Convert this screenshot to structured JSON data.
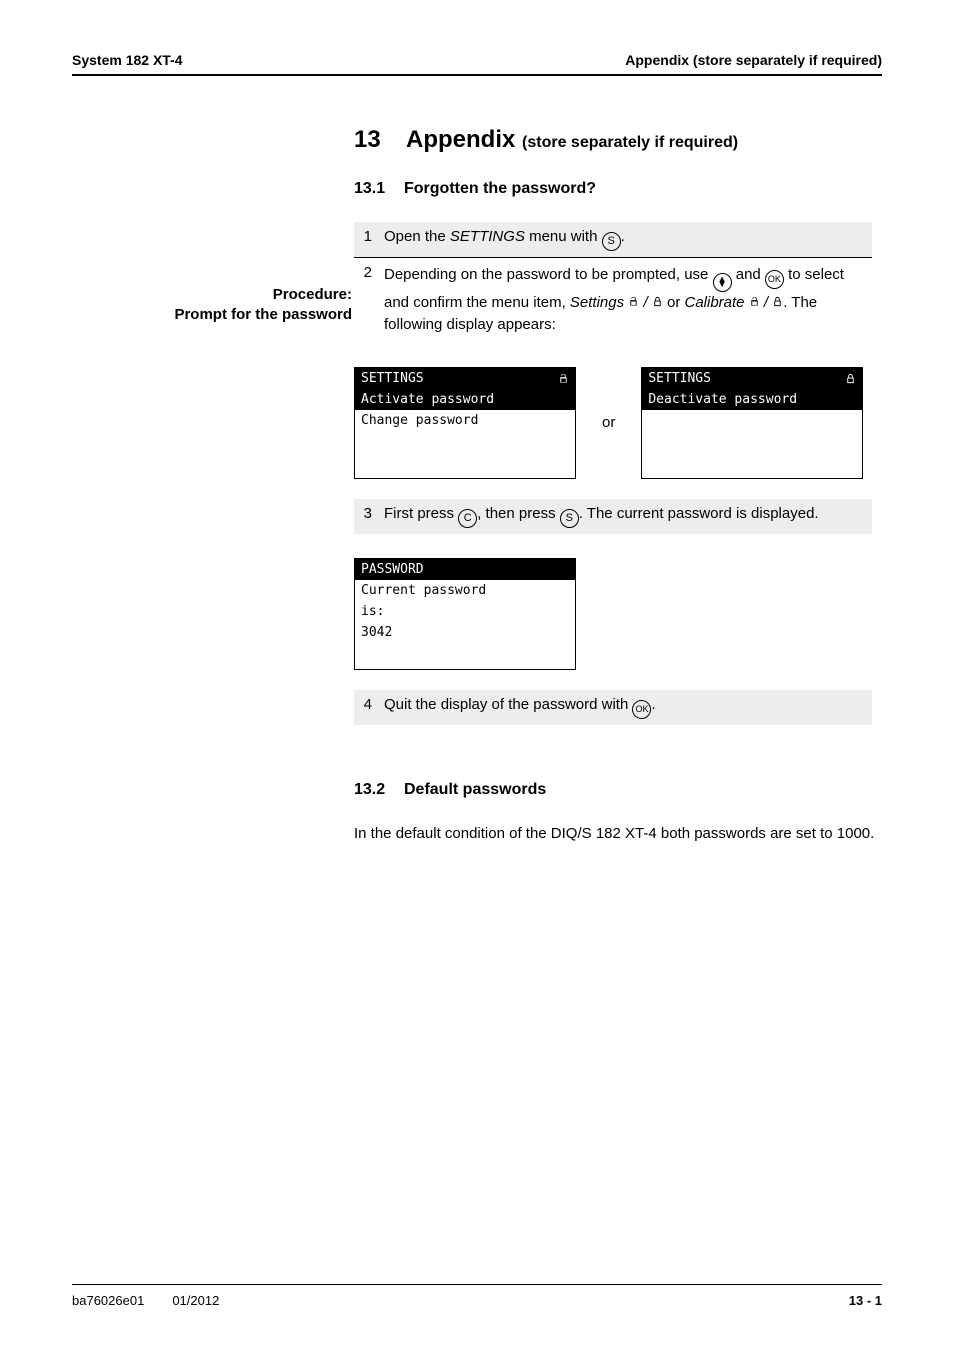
{
  "header": {
    "left": "System 182 XT-4",
    "right": "Appendix (store separately if required)"
  },
  "h1": {
    "num": "13",
    "title": "Appendix",
    "suffix": "(store separately if required)"
  },
  "h2a": {
    "num": "13.1",
    "title": "Forgotten the password?"
  },
  "side_label": {
    "line1": "Procedure:",
    "line2": "Prompt for the password"
  },
  "steps1": {
    "r1": {
      "n": "1",
      "t1": "Open the ",
      "it1": "SETTINGS",
      "t2": " menu with ",
      "btn": "S",
      "t3": "."
    },
    "r2": {
      "n": "2",
      "t1": "Depending on the password to be prompted, use ",
      "btn_ud": "▲▼",
      "t2": " and ",
      "btn_ok": "OK",
      "t3": " to select and confirm the menu item, ",
      "it1": "Settings ",
      "t4": " or ",
      "it2": "Calibrate ",
      "t5": ". The following display appears:"
    }
  },
  "lcd1": {
    "title": "SETTINGS",
    "line2": "Activate password",
    "line3": "Change password"
  },
  "or_word": "or",
  "lcd2": {
    "title": "SETTINGS",
    "line2": "Deactivate password"
  },
  "steps2": {
    "r3": {
      "n": "3",
      "t1": "First press ",
      "btn_c": "C",
      "t2": ", then press ",
      "btn_s": "S",
      "t3": ". The current password is displayed."
    }
  },
  "lcd3": {
    "title": "PASSWORD",
    "line2": "Current password",
    "line3": "is:",
    "line4": "3042"
  },
  "steps3": {
    "r4": {
      "n": "4",
      "t1": "Quit the display of the password with ",
      "btn_ok": "OK",
      "t2": "."
    }
  },
  "h2b": {
    "num": "13.2",
    "title": "Default passwords"
  },
  "body2": "In the default condition of the DIQ/S 182 XT-4 both passwords are set to 1000.",
  "footer": {
    "doc": "ba76026e01",
    "date": "01/2012",
    "page": "13 - 1"
  },
  "chart_data": {
    "type": "table",
    "title": "Procedure: Prompt for the password",
    "columns": [
      "Step",
      "Action"
    ],
    "rows": [
      [
        1,
        "Open the SETTINGS menu with (S)."
      ],
      [
        2,
        "Depending on the password to be prompted, use (up/down) and (OK) to select and confirm the menu item, Settings (unlocked/locked) or Calibrate (unlocked/locked). The following display appears:"
      ],
      [
        3,
        "First press (C), then press (S). The current password is displayed."
      ],
      [
        4,
        "Quit the display of the password with (OK)."
      ]
    ],
    "lcd_screens": [
      {
        "title": "SETTINGS (unlocked)",
        "lines": [
          "Activate password",
          "Change password"
        ],
        "highlighted": "Activate password"
      },
      {
        "title": "SETTINGS (locked)",
        "lines": [
          "Deactivate password"
        ],
        "highlighted": "Deactivate password"
      },
      {
        "title": "PASSWORD",
        "lines": [
          "Current password",
          "is:",
          "3042"
        ]
      }
    ],
    "default_passwords": 1000
  }
}
